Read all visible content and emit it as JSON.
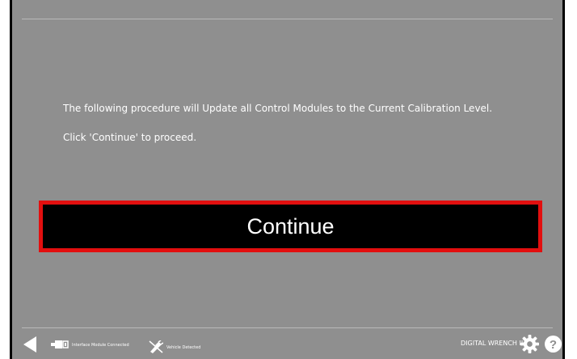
{
  "main": {
    "message_line_1": "The following procedure will Update all Control Modules to the Current Calibration Level.",
    "message_line_2": "Click 'Continue' to proceed.",
    "continue_label": "Continue"
  },
  "footer": {
    "back_icon": "back-arrow-icon",
    "interface_status": "Interface Module Connected",
    "interface_icon": "interface-module-icon",
    "vehicle_status": "Vehicle Detected",
    "vehicle_icon": "vehicle-plug-icon",
    "brand": "DIGITAL WRENCH II",
    "settings_icon": "gear-icon",
    "help_icon": "help-icon"
  },
  "colors": {
    "background": "#8f8f8f",
    "button_fill": "#000000",
    "button_border": "#e20f0f",
    "text": "#ffffff"
  }
}
